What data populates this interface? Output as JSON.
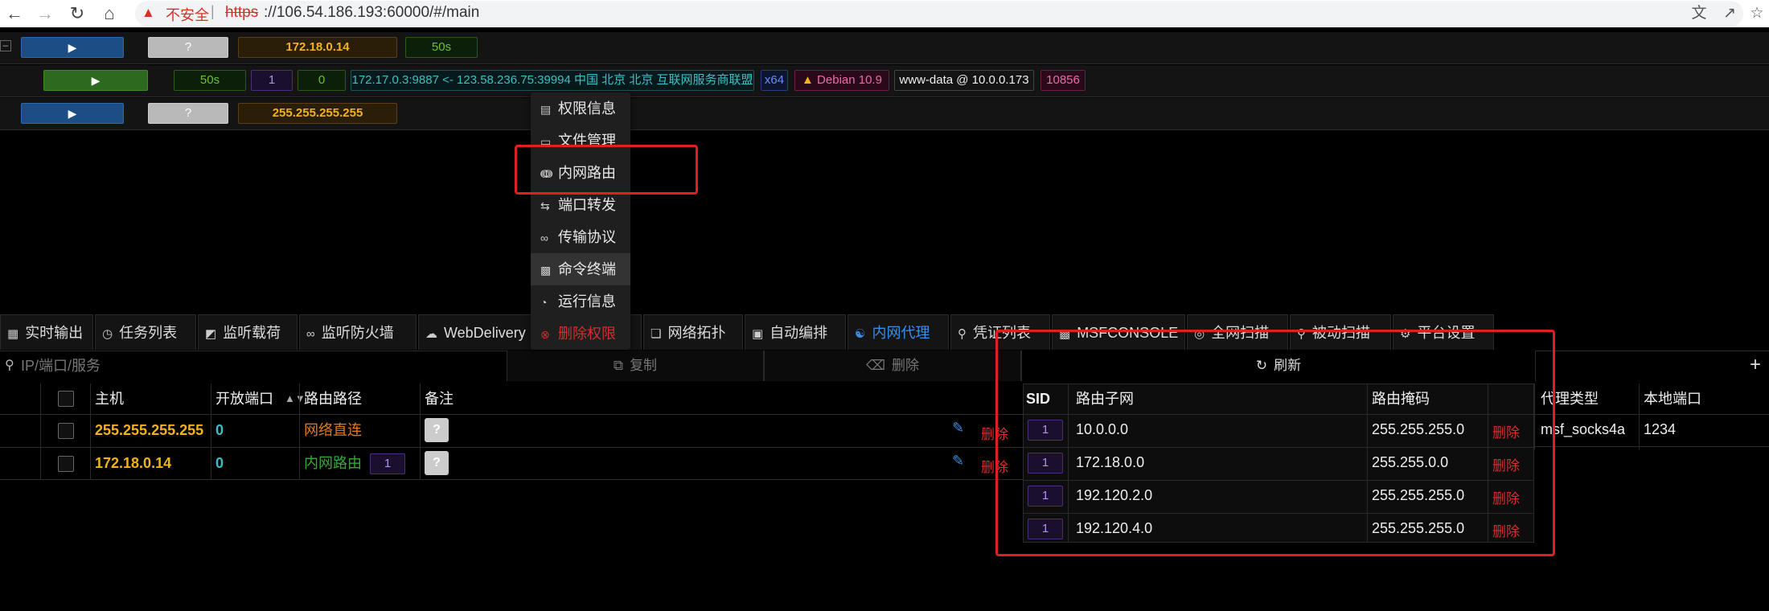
{
  "browser": {
    "insecure_label": "不安全",
    "url_scheme": "https",
    "url_rest": "://106.54.186.193:60000/#/main"
  },
  "sessions": [
    {
      "ip": "172.18.0.14",
      "time": "50s",
      "play": "▶",
      "q": "?"
    },
    {
      "time": "50s",
      "count1": "1",
      "count2": "0",
      "conn": "172.17.0.3:9887 <- 123.58.236.75:39994 中国 北京 北京 互联网服务商联盟",
      "arch": "x64",
      "os": "Debian 10.9",
      "user": "www-data @ 10.0.0.173",
      "pid": "10856",
      "play": "▶"
    },
    {
      "ip": "255.255.255.255",
      "play": "▶",
      "q": "?"
    }
  ],
  "context_menu": {
    "items": [
      {
        "label": "权限信息",
        "icon": "info-card-icon"
      },
      {
        "label": "文件管理",
        "icon": "monitor-icon"
      },
      {
        "label": "内网路由",
        "icon": "share-nodes-icon"
      },
      {
        "label": "端口转发",
        "icon": "swap-arrows-icon"
      },
      {
        "label": "传输协议",
        "icon": "link-icon"
      },
      {
        "label": "命令终端",
        "icon": "terminal-icon"
      },
      {
        "label": "运行信息",
        "icon": "dashboard-icon"
      },
      {
        "label": "删除权限",
        "icon": "close-circle-icon"
      }
    ]
  },
  "tabs": [
    {
      "label": "实时输出",
      "icon": "code-icon"
    },
    {
      "label": "任务列表",
      "icon": "clock-icon"
    },
    {
      "label": "监听载荷",
      "icon": "headset-icon"
    },
    {
      "label": "监听防火墙",
      "icon": "link-icon"
    },
    {
      "label": "WebDelivery",
      "icon": "cloud-upload-icon"
    },
    {
      "label": "网络拓扑",
      "icon": "topology-icon"
    },
    {
      "label": "自动编排",
      "icon": "robot-icon"
    },
    {
      "label": "内网代理",
      "icon": "proxy-icon",
      "active": true
    },
    {
      "label": "凭证列表",
      "icon": "key-icon"
    },
    {
      "label": "MSFCONSOLE",
      "icon": "console-icon"
    },
    {
      "label": "全网扫描",
      "icon": "radar-icon"
    },
    {
      "label": "被动扫描",
      "icon": "search-icon"
    },
    {
      "label": "平台设置",
      "icon": "gear-icon"
    }
  ],
  "toolbar": {
    "search_placeholder": "IP/端口/服务",
    "copy_label": "复制",
    "delete_label": "删除",
    "refresh_label": "刷新",
    "add_label": "+"
  },
  "host_table": {
    "columns": [
      "主机",
      "开放端口",
      "路由路径",
      "备注"
    ],
    "sort_icon": "sort-icon",
    "rows": [
      {
        "host": "255.255.255.255",
        "ports": "0",
        "path": "网络直连",
        "note": "?",
        "delete": "删除"
      },
      {
        "host": "172.18.0.14",
        "ports": "0",
        "path": "内网路由",
        "path_sid": "1",
        "note": "?",
        "delete": "删除"
      }
    ]
  },
  "route_table": {
    "columns": [
      "SID",
      "路由子网",
      "路由掩码"
    ],
    "rows": [
      {
        "sid": "1",
        "subnet": "10.0.0.0",
        "mask": "255.255.255.0",
        "delete": "删除"
      },
      {
        "sid": "1",
        "subnet": "172.18.0.0",
        "mask": "255.255.0.0",
        "delete": "删除"
      },
      {
        "sid": "1",
        "subnet": "192.120.2.0",
        "mask": "255.255.255.0",
        "delete": "删除"
      },
      {
        "sid": "1",
        "subnet": "192.120.4.0",
        "mask": "255.255.255.0",
        "delete": "删除"
      }
    ]
  },
  "proxy_table": {
    "columns": [
      "代理类型",
      "本地端口"
    ],
    "rows": [
      {
        "type": "msf_socks4a",
        "port": "1234"
      }
    ]
  },
  "colors": {
    "accent": "#3a8ee6",
    "danger": "#d32f2f",
    "highlight": "#e02020",
    "ip": "#f3b21b"
  }
}
